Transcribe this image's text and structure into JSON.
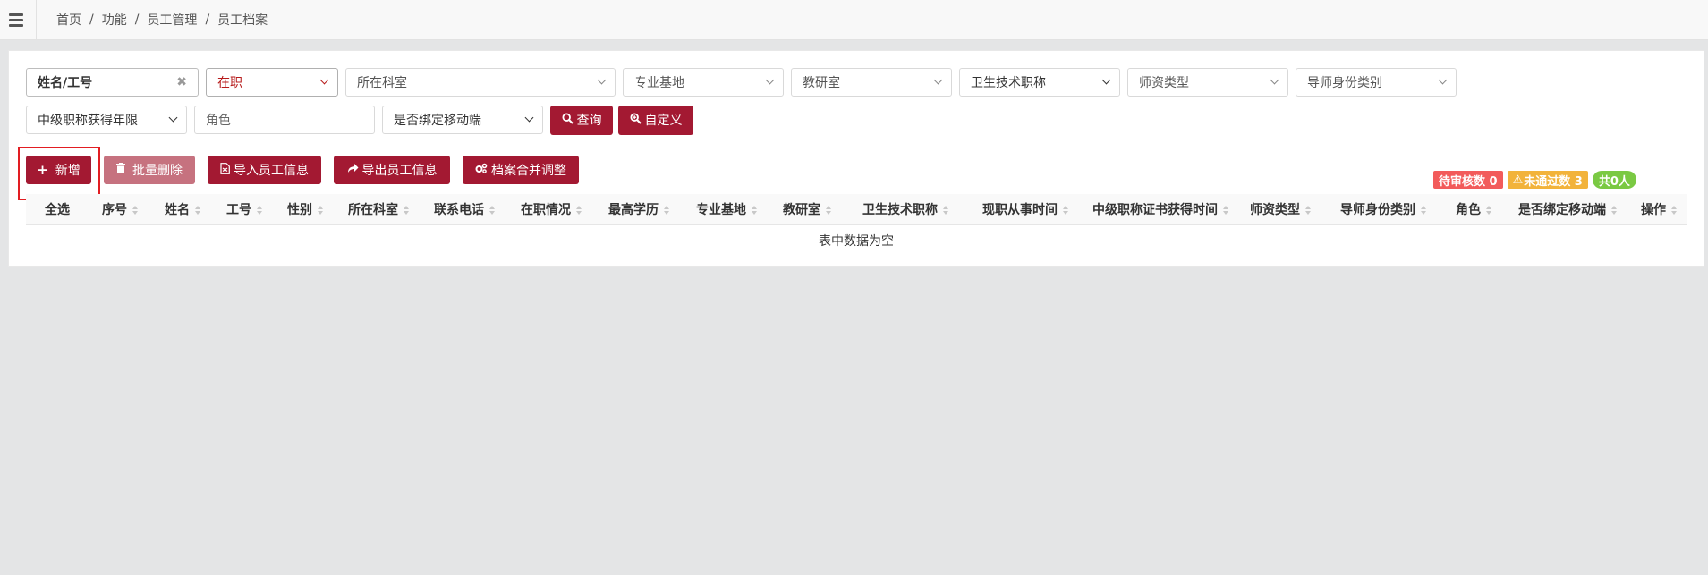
{
  "topbar": {
    "breadcrumb": [
      "首页",
      "功能",
      "员工管理",
      "员工档案"
    ]
  },
  "filters": {
    "name_input": {
      "value": "姓名/工号"
    },
    "status_select": {
      "value": "在职"
    },
    "department_select": {
      "value": "所在科室"
    },
    "base_select": {
      "value": "专业基地"
    },
    "teaching_office_select": {
      "value": "教研室"
    },
    "tech_title_select": {
      "value": "卫生技术职称"
    },
    "teacher_type_select": {
      "value": "师资类型"
    },
    "mentor_type_select": {
      "value": "导师身份类别"
    },
    "mid_title_year_select": {
      "value": "中级职称获得年限"
    },
    "role_input": {
      "placeholder": "角色"
    },
    "mobile_bind_select": {
      "value": "是否绑定移动端"
    },
    "query_button": "查询",
    "custom_button": "自定义"
  },
  "actions": {
    "add": "新增",
    "batch_delete": "批量删除",
    "import": "导入员工信息",
    "export": "导出员工信息",
    "merge": "档案合并调整"
  },
  "badges": {
    "pending": "待审核数 0",
    "rejected": "未通过数 3",
    "total": "共0人"
  },
  "table": {
    "headers": [
      "全选",
      "序号",
      "姓名",
      "工号",
      "性别",
      "所在科室",
      "联系电话",
      "在职情况",
      "最高学历",
      "专业基地",
      "教研室",
      "卫生技术职称",
      "现职从事时间",
      "中级职称证书获得时间",
      "师资类型",
      "导师身份类别",
      "角色",
      "是否绑定移动端",
      "操作"
    ],
    "empty_message": "表中数据为空"
  },
  "colors": {
    "primary": "#a31932",
    "disabled": "#c6727f",
    "pending_badge": "#f25b5b",
    "warn_badge": "#f2b33b",
    "total_badge": "#7ac943",
    "highlight_box": "#e21d22"
  }
}
